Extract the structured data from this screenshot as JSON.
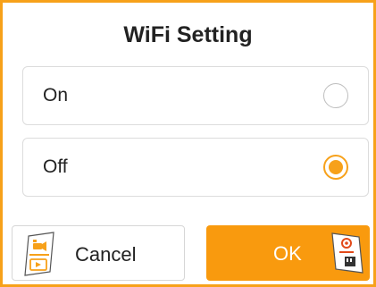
{
  "dialog": {
    "title": "WiFi Setting",
    "options": [
      {
        "label": "On",
        "selected": false
      },
      {
        "label": "Off",
        "selected": true
      }
    ],
    "buttons": {
      "cancel_label": "Cancel",
      "ok_label": "OK"
    },
    "icons": {
      "cancel": "video-playback-icon",
      "ok": "settings-sd-card-icon"
    }
  },
  "colors": {
    "accent": "#f7a11a",
    "ok_button": "#f99a0e",
    "option_border": "#dcdcdc"
  }
}
